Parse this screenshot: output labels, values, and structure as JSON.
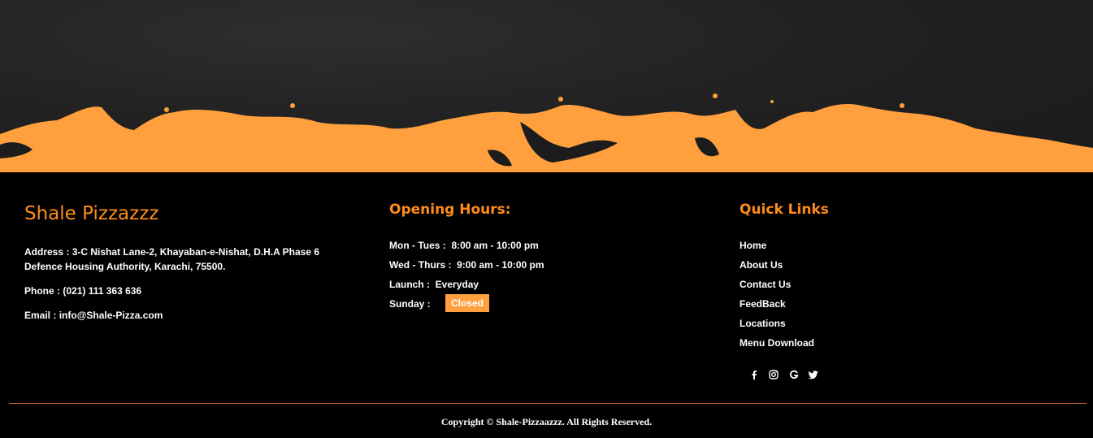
{
  "colors": {
    "accent": "#ff8c1a",
    "splash": "#ff9f3d",
    "background": "#000000",
    "chalkboard": "#222222"
  },
  "brand": {
    "name": "Shale Pizzazzz",
    "address_label": "Address :",
    "address_line1": "3-C Nishat Lane-2, Khayaban-e-Nishat, D.H.A Phase 6",
    "address_line2": "Defence Housing Authority, Karachi, 75500.",
    "phone_label": "Phone :",
    "phone": "(021) 111 363 636",
    "email_label": "Email :",
    "email": "info@Shale-Pizza.com"
  },
  "hours": {
    "title": "Opening Hours:",
    "rows": [
      {
        "day": "Mon - Tues :",
        "time": "8:00 am - 10:00 pm"
      },
      {
        "day": "Wed - Thurs :",
        "time": "9:00 am - 10:00 pm"
      },
      {
        "day": "Launch :",
        "time": "Everyday"
      }
    ],
    "sunday_label": "Sunday :",
    "sunday_status": "Closed"
  },
  "links": {
    "title": "Quick Links",
    "items": [
      "Home",
      "About Us",
      "Contact Us",
      "FeedBack",
      "Locations",
      "Menu Download"
    ]
  },
  "social": {
    "icons": [
      "facebook-icon",
      "instagram-icon",
      "google-icon",
      "twitter-icon"
    ]
  },
  "footer": {
    "copyright": "Copyright © Shale-Pizzaazzz. All Rights Reserved."
  }
}
